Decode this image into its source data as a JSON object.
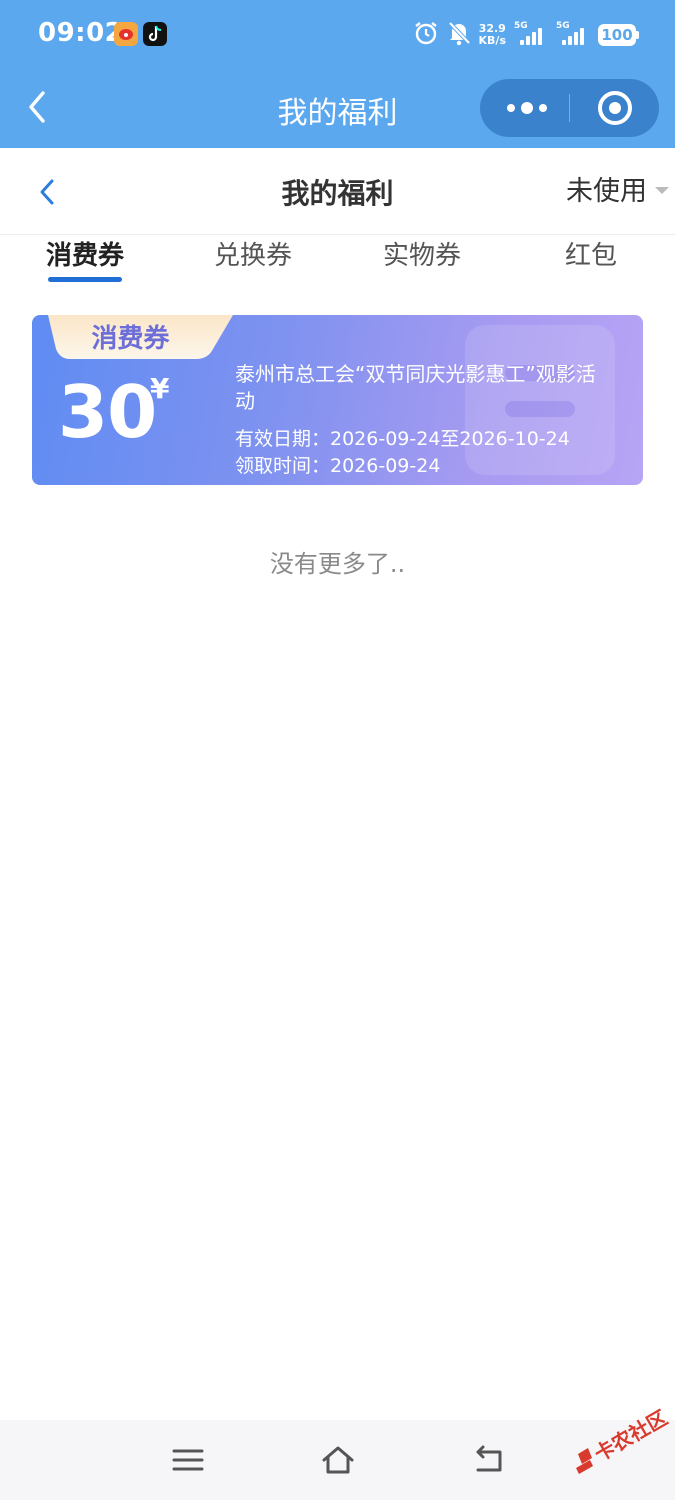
{
  "status_bar": {
    "time": "09:02",
    "net_speed_value": "32.9",
    "net_speed_unit": "KB/s",
    "sim1_label": "5G",
    "sim2_label": "5G",
    "battery": "100"
  },
  "nav_bar": {
    "title": "我的福利"
  },
  "page_header": {
    "title": "我的福利",
    "filter_label": "未使用"
  },
  "tabs": [
    {
      "label": "消费券",
      "active": true
    },
    {
      "label": "兑换券",
      "active": false
    },
    {
      "label": "实物券",
      "active": false
    },
    {
      "label": "红包",
      "active": false
    }
  ],
  "coupon": {
    "tag": "消费券",
    "amount": "30",
    "currency": "¥",
    "title": "泰州市总工会“双节同庆光影惠工”观影活动",
    "valid_period": "有效日期：2026-09-24至2026-10-24",
    "received_time": "领取时间：2026-09-24"
  },
  "list_end_text": "没有更多了..",
  "watermark": "卡农社区",
  "colors": {
    "top_bar": "#5ba8ee",
    "capsule": "#3b82cc",
    "tab_underline": "#1f6fd6",
    "coupon_gradient_start": "#5f8cf3",
    "coupon_gradient_end": "#b7a4f5"
  }
}
